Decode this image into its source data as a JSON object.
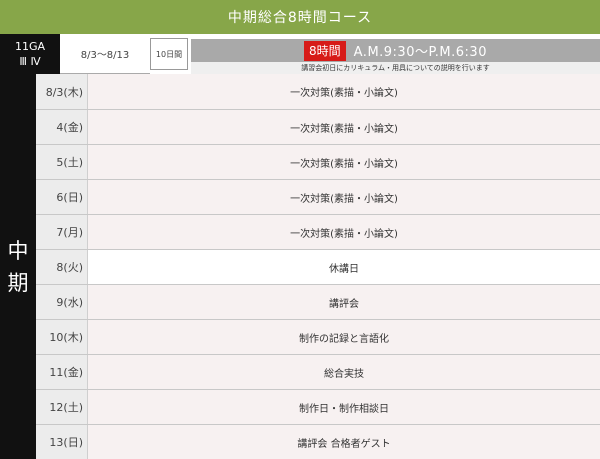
{
  "title": "中期総合8時間コース",
  "class_info": {
    "code": "11GA",
    "sections": "Ⅲ Ⅳ"
  },
  "date_range": "8/3〜8/13",
  "days_count": "10日間",
  "hours": {
    "badge": "8時間",
    "time": "A.M.9:30〜P.M.6:30",
    "note": "講習会初日にカリキュラム・用具についての説明を行います"
  },
  "term_label": [
    "中",
    "期"
  ],
  "schedule": [
    {
      "date": "8/3(木)",
      "content": "一次対策(素描・小論文)",
      "highlight": false
    },
    {
      "date": "4(金)",
      "content": "一次対策(素描・小論文)",
      "highlight": false
    },
    {
      "date": "5(土)",
      "content": "一次対策(素描・小論文)",
      "highlight": false
    },
    {
      "date": "6(日)",
      "content": "一次対策(素描・小論文)",
      "highlight": false
    },
    {
      "date": "7(月)",
      "content": "一次対策(素描・小論文)",
      "highlight": false
    },
    {
      "date": "8(火)",
      "content": "休講日",
      "highlight": true
    },
    {
      "date": "9(水)",
      "content": "講評会",
      "highlight": false
    },
    {
      "date": "10(木)",
      "content": "制作の記録と言語化",
      "highlight": false
    },
    {
      "date": "11(金)",
      "content": "総合実技",
      "highlight": false
    },
    {
      "date": "12(土)",
      "content": "制作日・制作相談日",
      "highlight": false
    },
    {
      "date": "13(日)",
      "content": "講評会 合格者ゲスト",
      "highlight": false
    }
  ],
  "colors": {
    "title_bar": "#87a649",
    "dark": "#111111",
    "badge_red": "#d71b18",
    "hours_gray": "#a9a9a9",
    "row_pink": "#f7f1f1"
  }
}
